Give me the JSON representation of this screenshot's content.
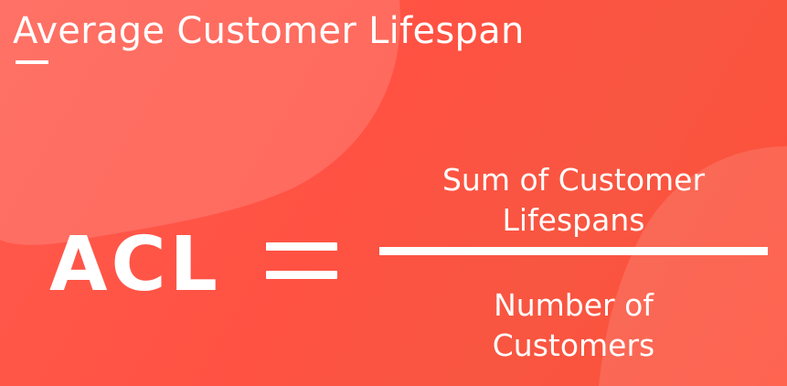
{
  "title": "Average Customer Lifespan",
  "formula": {
    "lhs": "ACL",
    "numerator_lines": [
      "Sum of Customer",
      "Lifespans"
    ],
    "denominator_lines": [
      "Number of",
      "Customers"
    ]
  },
  "colors": {
    "background": "#ff5445",
    "text": "#ffffff"
  }
}
